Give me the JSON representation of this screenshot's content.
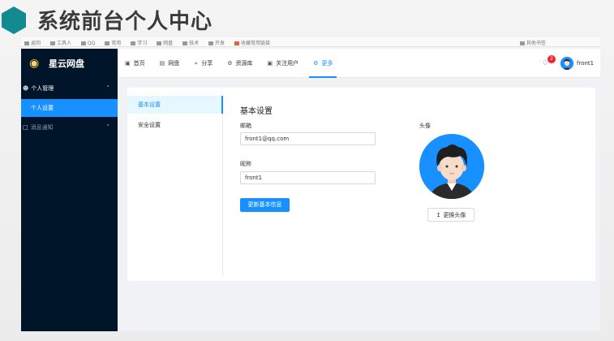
{
  "slide": {
    "title": "系统前台个人中心"
  },
  "browser": {
    "bookmarks": [
      "返回",
      "工具人",
      "QQ",
      "常用",
      "学习",
      "网盘",
      "技术",
      "开发",
      "收藏常用链接",
      "其他书签"
    ]
  },
  "app": {
    "logo_text": "星云网盘",
    "sidebar": {
      "group1_label": "个人管理",
      "active_item_label": "个人设置",
      "group2_label": "消息通知"
    },
    "nav": [
      {
        "label": "首页",
        "icon": "home-icon"
      },
      {
        "label": "网盘",
        "icon": "folder-icon"
      },
      {
        "label": "分享",
        "icon": "share-icon"
      },
      {
        "label": "资源库",
        "icon": "database-icon"
      },
      {
        "label": "关注用户",
        "icon": "users-icon"
      },
      {
        "label": "更多",
        "icon": "gear-icon"
      }
    ],
    "notification_count": "2",
    "username": "front1"
  },
  "settings": {
    "tabs": [
      "基本设置",
      "安全设置"
    ],
    "title": "基本设置",
    "email_label": "邮箱",
    "email_value": "front1@qq.com",
    "nickname_label": "昵称",
    "nickname_value": "front1",
    "update_button": "更新基本信息",
    "avatar_label": "头像",
    "change_avatar_button": "更换头像"
  },
  "colors": {
    "primary": "#1890ff",
    "sidebar": "#001529",
    "accent_hex": "#138a8f"
  }
}
